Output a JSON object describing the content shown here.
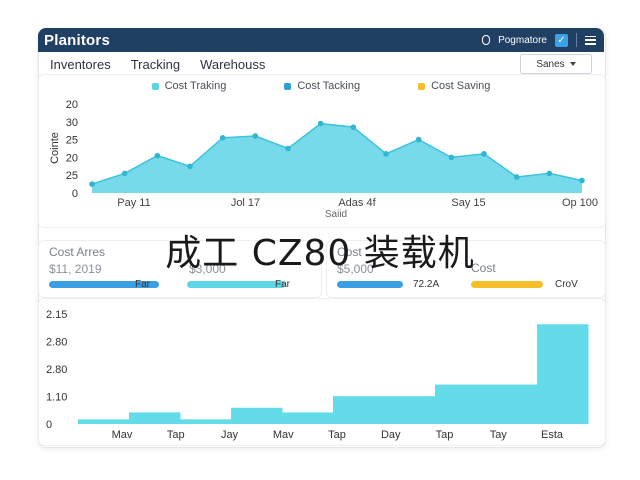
{
  "app": {
    "brand": "Planitors",
    "user_label": "Pogmatore",
    "check_glyph": "✓",
    "menu_icon": "hamburger-menu-icon"
  },
  "nav": {
    "tabs": [
      "Inventores",
      "Tracking",
      "Warehouss"
    ],
    "select_value": "Sanes"
  },
  "legend": [
    {
      "label": "Cost Traking",
      "color": "#5ed3e6"
    },
    {
      "label": "Cost Tacking",
      "color": "#2e9fd9"
    },
    {
      "label": "Cost Saving",
      "color": "#f4bf2a"
    }
  ],
  "top_chart": {
    "y_ticks": [
      "20",
      "30",
      "25",
      "20",
      "25",
      "0"
    ],
    "y_label": "Cointe",
    "x_ticks": [
      "Pay 11",
      "Jol 17",
      "Adas 4f",
      "Say 15",
      "Op 100"
    ],
    "x_label": "Saiid",
    "series_values": [
      0.1,
      0.22,
      0.42,
      0.3,
      0.62,
      0.64,
      0.5,
      0.78,
      0.74,
      0.44,
      0.6,
      0.4,
      0.44,
      0.18,
      0.22,
      0.14
    ],
    "color": "#5ed3e6",
    "line_color": "#3cc3da"
  },
  "kpis": [
    {
      "title": "Cost Arres",
      "value": "$11, 2019",
      "bar_label": "Far",
      "bar_color": "#3a9fe3"
    },
    {
      "title": "",
      "value": "$3,000",
      "bar_label": "Far",
      "bar_color": "#5ed6e6"
    },
    {
      "title": "Cost",
      "value": "$5,000",
      "bar_label": "72.2A",
      "bar_color": "#3a9fe3"
    },
    {
      "title": "Cost",
      "value": "",
      "bar_label": "CroV",
      "bar_color": "#f4bf2a"
    }
  ],
  "bottom_chart": {
    "y_ticks": [
      "2.15",
      "2.80",
      "2.80",
      "1.10",
      "0"
    ],
    "x_ticks": [
      "Mav",
      "Tap",
      "Jay",
      "Mav",
      "Tap",
      "Day",
      "Tap",
      "Tay",
      "Esta"
    ],
    "step_values": [
      0.04,
      0.1,
      0.04,
      0.14,
      0.1,
      0.24,
      0.24,
      0.34,
      0.34,
      0.86
    ],
    "color": "#63dbe8"
  },
  "overlay_title": "成工 CZ80 装载机"
}
